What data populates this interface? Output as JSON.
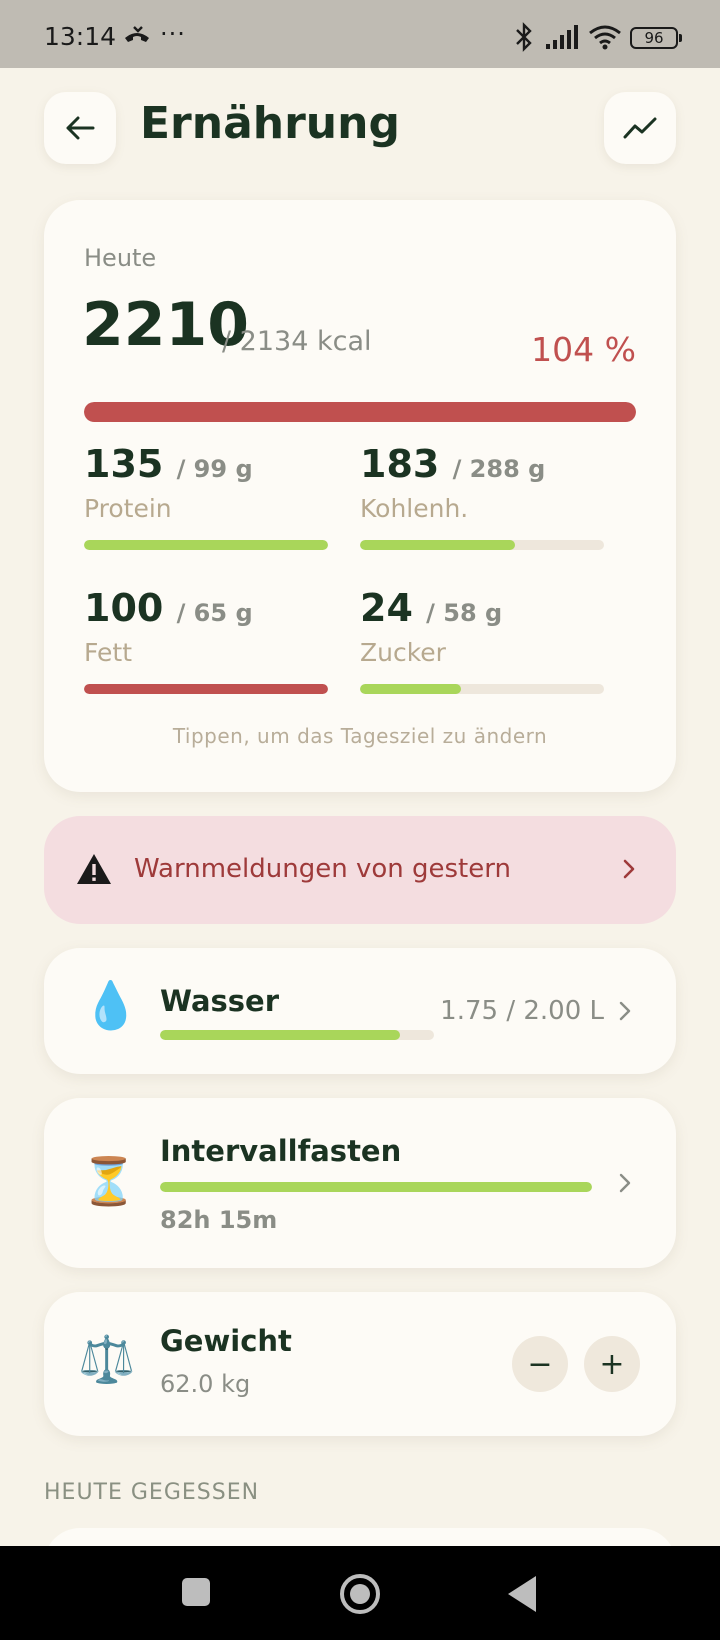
{
  "status_bar": {
    "time": "13:14",
    "dots": "···",
    "battery": "96"
  },
  "header": {
    "title": "Ernährung",
    "back_icon": "arrow-left-icon",
    "trend_icon": "trend-line-icon"
  },
  "summary": {
    "label": "Heute",
    "kcal": "2210",
    "kcal_goal": "/ 2134 kcal",
    "percent": "104 %",
    "progress": 1.0,
    "progress_color": "#c0504f",
    "hint": "Tippen, um das Tagesziel zu ändern",
    "macros": [
      {
        "value": "135",
        "goal": "/ 99 g",
        "name": "Protein",
        "progress": 1.0,
        "color": "#a9d65a"
      },
      {
        "value": "183",
        "goal": "/ 288 g",
        "name": "Kohlenh.",
        "progress": 0.635,
        "color": "#a9d65a"
      },
      {
        "value": "100",
        "goal": "/ 65 g",
        "name": "Fett",
        "progress": 1.0,
        "color": "#c0504f"
      },
      {
        "value": "24",
        "goal": "/ 58 g",
        "name": "Zucker",
        "progress": 0.414,
        "color": "#a9d65a"
      }
    ]
  },
  "warning": {
    "icon": "warning-triangle-icon",
    "text": "Warnmeldungen von gestern"
  },
  "water": {
    "emoji": "💧",
    "title": "Wasser",
    "value": "1.75 / 2.00 L",
    "progress": 0.875
  },
  "fasting": {
    "emoji": "⏳",
    "title": "Intervallfasten",
    "elapsed": "82h 15m",
    "progress": 1.0
  },
  "weight": {
    "emoji": "⚖️",
    "title": "Gewicht",
    "value": "62.0 kg",
    "minus": "−",
    "plus": "+"
  },
  "eaten_section": {
    "label": "HEUTE GEGESSEN"
  },
  "colors": {
    "accent_green": "#a9d65a",
    "accent_red": "#c0504f",
    "background": "#f7f3e9",
    "card": "#fdfbf6",
    "warning_bg": "#f4dde0"
  }
}
